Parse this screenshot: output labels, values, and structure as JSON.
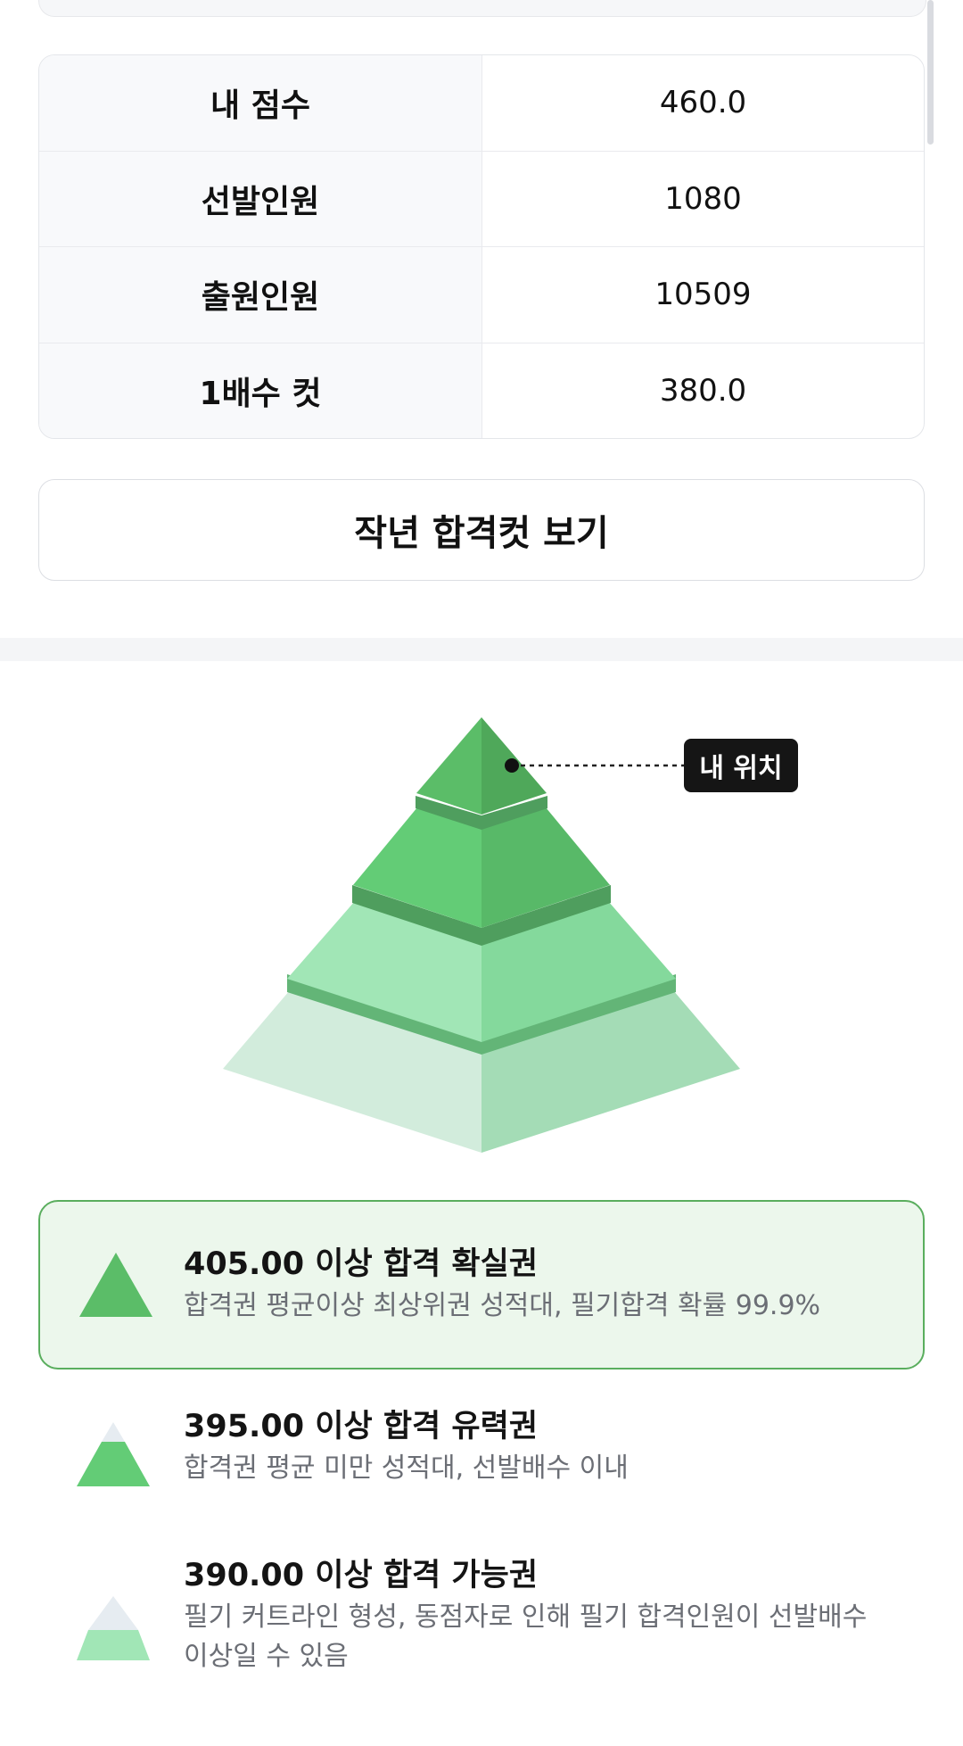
{
  "table": {
    "rows": [
      {
        "label": "내 점수",
        "value": "460.0"
      },
      {
        "label": "선발인원",
        "value": "1080"
      },
      {
        "label": "출원인원",
        "value": "10509"
      },
      {
        "label": "1배수 컷",
        "value": "380.0"
      }
    ]
  },
  "last_year_button": {
    "label": "작년 합격컷 보기"
  },
  "pyramid": {
    "my_position_label": "내 위치",
    "colors": {
      "tier1_left": "#5bbd68",
      "tier1_right": "#4fa85a",
      "tier2_left": "#63cc76",
      "tier2_right": "#58b968",
      "tier3_left": "#a1e6b6",
      "tier3_right": "#84d99c",
      "tier4_left": "#d2ecdc",
      "tier4_right": "#a4dcb6",
      "band_dark": "#4f9e5e",
      "band_mid": "#63b577"
    }
  },
  "legend": {
    "items": [
      {
        "title": "405.00 이상 합격 확실권",
        "desc": "합격권 평균이상 최상위권 성적대, 필기합격 확률 99.9%",
        "highlighted": true
      },
      {
        "title": "395.00 이상 합격 유력권",
        "desc": "합격권 평균 미만 성적대, 선발배수 이내",
        "highlighted": false
      },
      {
        "title": "390.00 이상 합격 가능권",
        "desc": "필기 커트라인 형성, 동점자로 인해 필기 합격인원이 선발배수 이상일 수 있음",
        "highlighted": false
      }
    ],
    "highlight_bg": "#ecf7ec",
    "highlight_border": "#5aae5e"
  }
}
